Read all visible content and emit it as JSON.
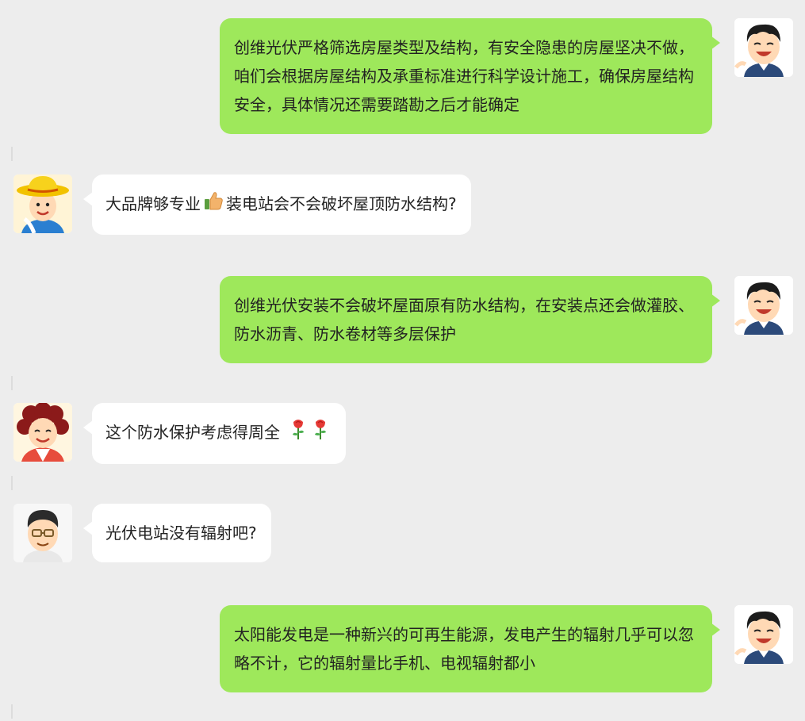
{
  "chat": {
    "messages": [
      {
        "side": "right",
        "avatar": "boy-avatar",
        "text": "创维光伏严格筛选房屋类型及结构，有安全隐患的房屋坚决不做，咱们会根据房屋结构及承重标准进行科学设计施工，确保房屋结构安全，具体情况还需要踏勘之后才能确定"
      },
      {
        "side": "left",
        "avatar": "farmer-avatar",
        "text_before": "大品牌够专业",
        "emoji": "thumbs-up-icon",
        "text_after": "装电站会不会破坏屋顶防水结构?"
      },
      {
        "side": "right",
        "avatar": "boy-avatar",
        "text": "创维光伏安装不会破坏屋面原有防水结构，在安装点还会做灌胶、防水沥青、防水卷材等多层保护"
      },
      {
        "side": "left",
        "avatar": "auntie-avatar",
        "text_before": "这个防水保护考虑得周全",
        "emoji": "rose-icon"
      },
      {
        "side": "left",
        "avatar": "uncle-avatar",
        "text_before": "光伏电站没有辐射吧?"
      },
      {
        "side": "right",
        "avatar": "boy-avatar",
        "text": "太阳能发电是一种新兴的可再生能源，发电产生的辐射几乎可以忽略不计，它的辐射量比手机、电视辐射都小"
      }
    ]
  },
  "colors": {
    "background": "#ededed",
    "self_bubble": "#9ee85b",
    "other_bubble": "#ffffff"
  }
}
